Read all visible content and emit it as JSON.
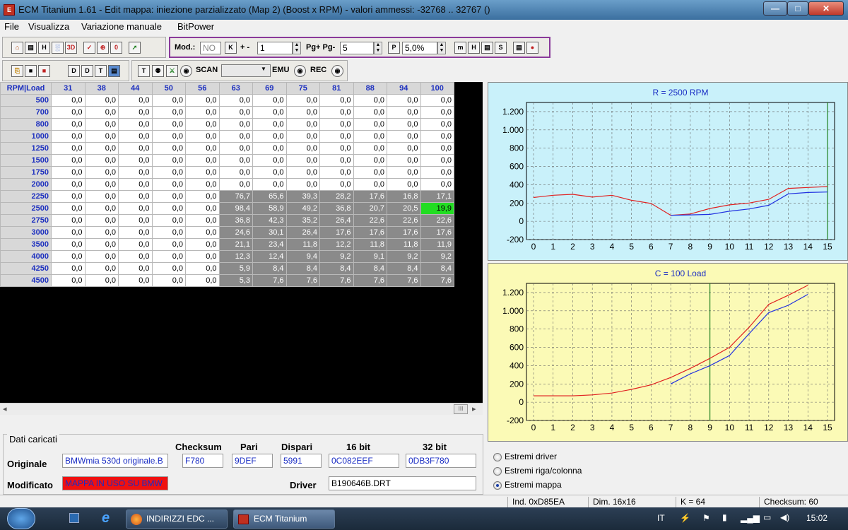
{
  "window": {
    "title": "ECM Titanium 1.61 - Edit mappa: iniezione parzializzato (Map 2) (Boost x RPM) - valori ammessi: -32768 .. 32767 ()",
    "app_icon": "ecm-icon",
    "min_label": "—",
    "max_label": "□",
    "close_label": "✕"
  },
  "menu": [
    "File",
    "Visualizza",
    "Variazione manuale",
    "BitPower"
  ],
  "toolbar1": {
    "buttons": [
      "⌂",
      "▤",
      "H",
      "░",
      "3D",
      "✓",
      "⊕",
      "0",
      "➚"
    ],
    "mod_label": "Mod.:",
    "mod_value": "NO",
    "k_label": "K",
    "plusminus_label": "+ -",
    "plusminus_value": "1",
    "pg_label": "Pg+ Pg-",
    "pg_value": "5",
    "p_label": "P",
    "percent_value": "5,0%",
    "right_buttons": [
      "m",
      "H",
      "▤",
      "S",
      "▤",
      "●"
    ]
  },
  "toolbar2": {
    "buttons": [
      "⎘",
      "■",
      "■",
      "D",
      "D",
      "T",
      "▤"
    ],
    "buttons2": [
      "T",
      "⚉",
      "⚔",
      "◉"
    ],
    "scan_label": "SCAN",
    "scan_value": "",
    "emu_label": "EMU",
    "rec_label": "REC"
  },
  "table": {
    "corner": "RPM|Load",
    "columns": [
      "31",
      "38",
      "44",
      "50",
      "56",
      "63",
      "69",
      "75",
      "81",
      "88",
      "94",
      "100"
    ],
    "rows": [
      {
        "rpm": "500",
        "values": [
          "0,0",
          "0,0",
          "0,0",
          "0,0",
          "0,0",
          "0,0",
          "0,0",
          "0,0",
          "0,0",
          "0,0",
          "0,0",
          "0,0"
        ]
      },
      {
        "rpm": "700",
        "values": [
          "0,0",
          "0,0",
          "0,0",
          "0,0",
          "0,0",
          "0,0",
          "0,0",
          "0,0",
          "0,0",
          "0,0",
          "0,0",
          "0,0"
        ]
      },
      {
        "rpm": "800",
        "values": [
          "0,0",
          "0,0",
          "0,0",
          "0,0",
          "0,0",
          "0,0",
          "0,0",
          "0,0",
          "0,0",
          "0,0",
          "0,0",
          "0,0"
        ]
      },
      {
        "rpm": "1000",
        "values": [
          "0,0",
          "0,0",
          "0,0",
          "0,0",
          "0,0",
          "0,0",
          "0,0",
          "0,0",
          "0,0",
          "0,0",
          "0,0",
          "0,0"
        ]
      },
      {
        "rpm": "1250",
        "values": [
          "0,0",
          "0,0",
          "0,0",
          "0,0",
          "0,0",
          "0,0",
          "0,0",
          "0,0",
          "0,0",
          "0,0",
          "0,0",
          "0,0"
        ]
      },
      {
        "rpm": "1500",
        "values": [
          "0,0",
          "0,0",
          "0,0",
          "0,0",
          "0,0",
          "0,0",
          "0,0",
          "0,0",
          "0,0",
          "0,0",
          "0,0",
          "0,0"
        ]
      },
      {
        "rpm": "1750",
        "values": [
          "0,0",
          "0,0",
          "0,0",
          "0,0",
          "0,0",
          "0,0",
          "0,0",
          "0,0",
          "0,0",
          "0,0",
          "0,0",
          "0,0"
        ]
      },
      {
        "rpm": "2000",
        "values": [
          "0,0",
          "0,0",
          "0,0",
          "0,0",
          "0,0",
          "0,0",
          "0,0",
          "0,0",
          "0,0",
          "0,0",
          "0,0",
          "0,0"
        ]
      },
      {
        "rpm": "2250",
        "values": [
          "0,0",
          "0,0",
          "0,0",
          "0,0",
          "0,0",
          "76,7",
          "65,6",
          "39,3",
          "28,2",
          "17,6",
          "16,8",
          "17,1"
        ]
      },
      {
        "rpm": "2500",
        "values": [
          "0,0",
          "0,0",
          "0,0",
          "0,0",
          "0,0",
          "98,4",
          "58,9",
          "49,2",
          "36,8",
          "20,7",
          "20,5",
          "19,9"
        ]
      },
      {
        "rpm": "2750",
        "values": [
          "0,0",
          "0,0",
          "0,0",
          "0,0",
          "0,0",
          "36,8",
          "42,3",
          "35,2",
          "26,4",
          "22,6",
          "22,6",
          "22,6"
        ]
      },
      {
        "rpm": "3000",
        "values": [
          "0,0",
          "0,0",
          "0,0",
          "0,0",
          "0,0",
          "24,6",
          "30,1",
          "26,4",
          "17,6",
          "17,6",
          "17,6",
          "17,6"
        ]
      },
      {
        "rpm": "3500",
        "values": [
          "0,0",
          "0,0",
          "0,0",
          "0,0",
          "0,0",
          "21,1",
          "23,4",
          "11,8",
          "12,2",
          "11,8",
          "11,8",
          "11,9"
        ]
      },
      {
        "rpm": "4000",
        "values": [
          "0,0",
          "0,0",
          "0,0",
          "0,0",
          "0,0",
          "12,3",
          "12,4",
          "9,4",
          "9,2",
          "9,1",
          "9,2",
          "9,2"
        ]
      },
      {
        "rpm": "4250",
        "values": [
          "0,0",
          "0,0",
          "0,0",
          "0,0",
          "0,0",
          "5,9",
          "8,4",
          "8,4",
          "8,4",
          "8,4",
          "8,4",
          "8,4"
        ]
      },
      {
        "rpm": "4500",
        "values": [
          "0,0",
          "0,0",
          "0,0",
          "0,0",
          "0,0",
          "5,3",
          "7,6",
          "7,6",
          "7,6",
          "7,6",
          "7,6",
          "7,6"
        ]
      }
    ],
    "scroll_left": "◂",
    "scroll_right": "▸",
    "scroll_thumb": "III"
  },
  "data_panel": {
    "group_label": "Dati caricati",
    "headers": {
      "checksum": "Checksum",
      "pari": "Pari",
      "dispari": "Dispari",
      "bit16": "16 bit",
      "bit32": "32 bit"
    },
    "originale_label": "Originale",
    "originale_name": "BMWmia 530d originale.B",
    "checksum": "F780",
    "pari": "9DEF",
    "dispari": "5991",
    "bit16": "0C082EEF",
    "bit32": "0DB3F780",
    "modificato_label": "Modificato",
    "modificato_value": "MAPPA IN USO SU BMW",
    "driver_label": "Driver",
    "driver_value": "B190646B.DRT"
  },
  "radios": [
    {
      "label": "Estremi driver",
      "checked": false
    },
    {
      "label": "Estremi riga/colonna",
      "checked": false
    },
    {
      "label": "Estremi mappa",
      "checked": true
    }
  ],
  "status": {
    "ind": "Ind. 0xD85EA",
    "dim": "Dim. 16x16",
    "k": "K = 64",
    "checksum": "Checksum: 60"
  },
  "taskbar": {
    "start_icon": "windows-start-icon",
    "tasks": [
      "INDIRIZZI EDC ...",
      "ECM Titanium"
    ],
    "lang": "IT",
    "time": "15:02"
  },
  "chart_data": [
    {
      "type": "line",
      "title": "R = 2500 RPM",
      "x": [
        0,
        1,
        2,
        3,
        4,
        5,
        6,
        7,
        8,
        9,
        10,
        11,
        12,
        13,
        14,
        15
      ],
      "yticks": [
        -200,
        0,
        200,
        400,
        600,
        800,
        "1.000",
        "1.200"
      ],
      "ylim": [
        -200,
        1300
      ],
      "cursor_x": 15,
      "background": "#c9f1fa",
      "series": [
        {
          "color": "#e02020",
          "values": [
            260,
            285,
            295,
            265,
            285,
            230,
            195,
            65,
            80,
            140,
            180,
            200,
            240,
            360,
            370,
            380
          ]
        },
        {
          "color": "#2030e0",
          "values": [
            null,
            null,
            null,
            null,
            null,
            null,
            null,
            65,
            70,
            75,
            110,
            135,
            175,
            300,
            315,
            320
          ]
        }
      ]
    },
    {
      "type": "line",
      "title": "C = 100 Load",
      "x": [
        0,
        1,
        2,
        3,
        4,
        5,
        6,
        7,
        8,
        9,
        10,
        11,
        12,
        13,
        14,
        15
      ],
      "yticks": [
        -200,
        0,
        200,
        400,
        600,
        800,
        "1.000",
        "1.200"
      ],
      "ylim": [
        -200,
        1300
      ],
      "cursor_x": 9,
      "background": "#fbfab6",
      "series": [
        {
          "color": "#e02020",
          "values": [
            70,
            70,
            70,
            80,
            100,
            140,
            190,
            270,
            370,
            480,
            600,
            820,
            1070,
            1170,
            1280
          ]
        },
        {
          "color": "#2030e0",
          "values": [
            null,
            null,
            null,
            null,
            null,
            null,
            null,
            200,
            310,
            400,
            510,
            750,
            980,
            1060,
            1180
          ]
        }
      ]
    }
  ]
}
